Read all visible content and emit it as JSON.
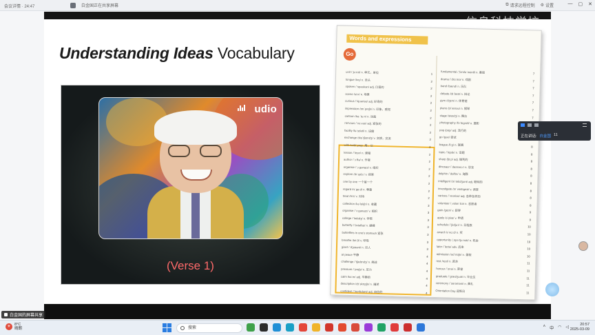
{
  "topbar": {
    "left_text": "会议详情 · 24:47",
    "tab_title": "白金国正在共享屏幕",
    "actions": [
      "请求远程控制",
      "设置"
    ],
    "win_controls": [
      "—",
      "▢",
      "✕"
    ]
  },
  "watermark": "信息科技学校",
  "slide": {
    "title_italic": "Understanding Ideas",
    "title_rest": " Vocabulary",
    "video_logo": "udio",
    "verse_label": "(Verse 1)"
  },
  "vocab": {
    "header": "Words and expressions",
    "unit_badge": "Go",
    "left_items": [
      {
        "text": "unit /ˈjuːnɪt/ n. 单元，单位",
        "num": "1"
      },
      {
        "text": "tongue /tʌŋ/ n. 舌头",
        "num": "2"
      },
      {
        "text": "spoken /ˈspəʊkən/ adj. 口语的",
        "num": "2"
      },
      {
        "text": "scene /siːn/ n. 场景",
        "num": "2"
      },
      {
        "text": "curious /ˈkjʊəriəs/ adj. 好奇的",
        "num": "2"
      },
      {
        "text": "impression /ɪmˈpreʃn/ n. 印象，感觉",
        "num": "2"
      },
      {
        "text": "cartoon /kɑːˈtuːn/ n. 动画",
        "num": "2"
      },
      {
        "text": "nervous /ˈnɜːvəs/ adj. 紧张的",
        "num": "2"
      },
      {
        "text": "facility /fəˈsɪləti/ n. 设施",
        "num": "2"
      },
      {
        "text": "exchange /ɪksˈtʃeɪndʒ/ v. 交换，交流",
        "num": "2"
      },
      {
        "text": "with /wɪð/ prep. 用，以",
        "num": "2"
      },
      {
        "text": "lesson /ˈlesn/ n. 课程",
        "num": "2"
      },
      {
        "text": "author /ˈɔːθə/ n. 作者",
        "num": "2"
      },
      {
        "text": "organise /ˈɔːɡənaɪz/ v. 组织",
        "num": "2"
      },
      {
        "text": "explore /ɪkˈsplɔː/ v. 探索",
        "num": "2"
      },
      {
        "text": "one by one 一个接一个",
        "num": "2"
      },
      {
        "text": "regard /rɪˈɡɑːd/ n. 尊重",
        "num": "2"
      },
      {
        "text": "treat /triːt/ v. 对待",
        "num": "2"
      },
      {
        "text": "collection /kəˈlekʃn/ n. 收藏",
        "num": "3"
      },
      {
        "text": "organise /ˈɔːɡənaɪz/ v. 组织",
        "num": "3"
      },
      {
        "text": "college /ˈkɒlɪdʒ/ n. 学院",
        "num": "3"
      },
      {
        "text": "butterfly /ˈbʌtəflaɪ/ n. 蝴蝶",
        "num": "3"
      },
      {
        "text": "butterflies in one's stomach 紧张",
        "num": "3"
      },
      {
        "text": "breathe /briːð/ v. 呼吸",
        "num": "3"
      },
      {
        "text": "giant /ˈdʒaɪənt/ n. 巨人",
        "num": "3"
      },
      {
        "text": "at peace 平静",
        "num": "4"
      },
      {
        "text": "challenge /ˈtʃælɪndʒ/ n. 挑战",
        "num": "4"
      },
      {
        "text": "pressure /ˈpreʃə/ n. 压力",
        "num": "4"
      },
      {
        "text": "calm /kɑːm/ adj. 平静的",
        "num": "4"
      },
      {
        "text": "description /dɪˈskrɪpʃn/ n. 描述",
        "num": "4"
      },
      {
        "text": "confident /ˈkɒnfɪdənt/ adj. 自信的",
        "num": "4"
      },
      {
        "text": "power /ˈpaʊə/ n. 力量",
        "num": "4"
      }
    ],
    "right_items": [
      {
        "text": "fundamental /ˌfʌndəˈmentl/ n. 基础",
        "num": "7"
      },
      {
        "text": "drama /ˈdrɑːmə/ n. 戏剧",
        "num": "7"
      },
      {
        "text": "band /bænd/ n. 乐队",
        "num": "7"
      },
      {
        "text": "debate /dɪˈbeɪt/ n. 辩论",
        "num": "7"
      },
      {
        "text": "gym /dʒɪm/ n. 体育馆",
        "num": "7"
      },
      {
        "text": "piano /piˈænəʊ/ n. 钢琴",
        "num": "7"
      },
      {
        "text": "stage /steɪdʒ/ n. 舞台",
        "num": "7"
      },
      {
        "text": "photography /fəˈtɒɡrəfi/ n. 摄影",
        "num": "7"
      },
      {
        "text": "pop /pɒp/ adj. 流行的",
        "num": "7"
      },
      {
        "text": "go /ɡəʊ/ 尝试",
        "num": "8"
      },
      {
        "text": "league /liːɡ/ n. 联赛",
        "num": "8"
      },
      {
        "text": "topic /ˈtɒpɪk/ n. 话题",
        "num": "8"
      },
      {
        "text": "sharp /ʃɑːp/ adj. 锋利的",
        "num": "8"
      },
      {
        "text": "dinosaur /ˈdaɪnəsɔː/ n. 恐龙",
        "num": "8"
      },
      {
        "text": "dolphin /ˈdɒlfɪn/ n. 海豚",
        "num": "8"
      },
      {
        "text": "intelligent /ɪnˈtelɪdʒənt/ adj. 聪明的",
        "num": "8"
      },
      {
        "text": "investigate /ɪnˈvestɪɡeɪt/ v. 调查",
        "num": "8"
      },
      {
        "text": "various /ˈveəriəs/ adj. 各种各样的",
        "num": "8"
      },
      {
        "text": "volunteer /ˌvɒlənˈtɪə/ n. 志愿者",
        "num": "8"
      },
      {
        "text": "gain /ɡeɪn/ v. 获得",
        "num": "9"
      },
      {
        "text": "apply /əˈplaɪ/ v. 申请",
        "num": "9"
      },
      {
        "text": "schedule /ˈʃedjuːl/ n. 日程表",
        "num": "10"
      },
      {
        "text": "award /əˈwɔːd/ n. 奖",
        "num": "10"
      },
      {
        "text": "opportunity /ˌɒpəˈtjuːnəti/ n. 机会",
        "num": "10"
      },
      {
        "text": "later /ˈleɪtə/ adv. 后来",
        "num": "10"
      },
      {
        "text": "admission /ədˈmɪʃn/ n. 录取",
        "num": "10"
      },
      {
        "text": "rest /rest/ n. 其余",
        "num": "11"
      },
      {
        "text": "honour /ˈɒnə/ n. 荣誉",
        "num": "11"
      },
      {
        "text": "graduate /ˈɡrædʒuət/ n. 毕业生",
        "num": "11"
      },
      {
        "text": "ceremony /ˈserəməni/ n. 典礼",
        "num": "11"
      },
      {
        "text": "Orientation Day 迎新日",
        "num": "11"
      }
    ]
  },
  "meeting_panel": {
    "speaking_label": "正在讲话:",
    "speaker": "白金国",
    "count": "11"
  },
  "presenter_label": "白金国的屏幕共享",
  "taskbar": {
    "weather_temp": "8°C",
    "weather_desc": "晴朗",
    "search_placeholder": "搜索",
    "time": "20:57",
    "date": "2025-03-09",
    "lang": "中"
  }
}
